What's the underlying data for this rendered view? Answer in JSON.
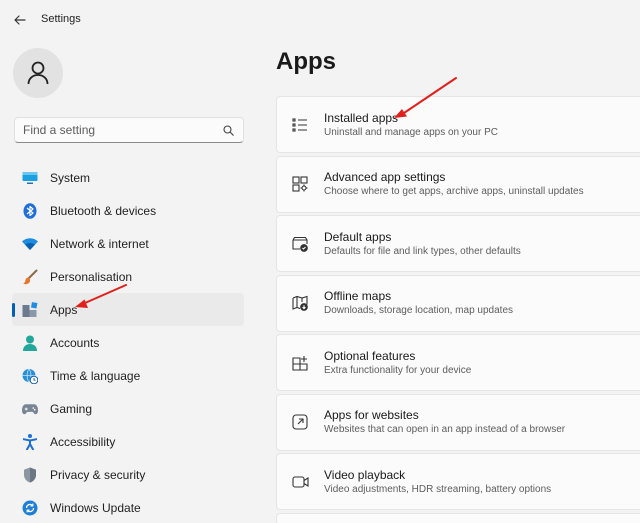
{
  "window": {
    "title": "Settings"
  },
  "search": {
    "placeholder": "Find a setting"
  },
  "nav": {
    "items": [
      {
        "label": "System",
        "icon": "monitor-icon"
      },
      {
        "label": "Bluetooth & devices",
        "icon": "bluetooth-icon"
      },
      {
        "label": "Network & internet",
        "icon": "wifi-icon"
      },
      {
        "label": "Personalisation",
        "icon": "paintbrush-icon"
      },
      {
        "label": "Apps",
        "icon": "apps-icon",
        "selected": true
      },
      {
        "label": "Accounts",
        "icon": "person-icon"
      },
      {
        "label": "Time & language",
        "icon": "globe-clock-icon"
      },
      {
        "label": "Gaming",
        "icon": "gamepad-icon"
      },
      {
        "label": "Accessibility",
        "icon": "accessibility-icon"
      },
      {
        "label": "Privacy & security",
        "icon": "shield-icon"
      },
      {
        "label": "Windows Update",
        "icon": "update-icon"
      }
    ]
  },
  "main": {
    "title": "Apps",
    "cards": [
      {
        "title": "Installed apps",
        "desc": "Uninstall and manage apps on your PC",
        "icon": "list-icon"
      },
      {
        "title": "Advanced app settings",
        "desc": "Choose where to get apps, archive apps, uninstall updates",
        "icon": "app-settings-icon"
      },
      {
        "title": "Default apps",
        "desc": "Defaults for file and link types, other defaults",
        "icon": "default-apps-icon"
      },
      {
        "title": "Offline maps",
        "desc": "Downloads, storage location, map updates",
        "icon": "map-icon"
      },
      {
        "title": "Optional features",
        "desc": "Extra functionality for your device",
        "icon": "optional-features-icon"
      },
      {
        "title": "Apps for websites",
        "desc": "Websites that can open in an app instead of a browser",
        "icon": "open-external-icon"
      },
      {
        "title": "Video playback",
        "desc": "Video adjustments, HDR streaming, battery options",
        "icon": "video-icon"
      }
    ]
  },
  "colors": {
    "accent": "#005fb8",
    "annotation_arrow": "#e0201b",
    "background": "#f3f3f3",
    "card": "#fbfbfb"
  }
}
